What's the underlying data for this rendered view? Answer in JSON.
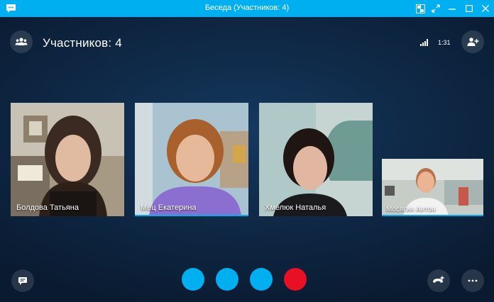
{
  "window": {
    "title": "Беседа (Участников: 4)"
  },
  "header": {
    "participants_label": "Участников: 4",
    "call_timer": "1:31"
  },
  "participants": [
    {
      "name": "Болдова Татьяна"
    },
    {
      "name": "Мец Екатерина"
    },
    {
      "name": "Хмелюк Наталья"
    },
    {
      "name": "Мосягин Антон"
    }
  ],
  "colors": {
    "accent": "#00aff0",
    "end_call": "#e81123",
    "background": "#0f2a48"
  },
  "icons": {
    "app": "skype-logo-icon",
    "participants": "people-icon",
    "add_people": "add-person-icon",
    "chat": "chat-icon",
    "dialpad": "call-add-icon",
    "more": "more-icon"
  }
}
